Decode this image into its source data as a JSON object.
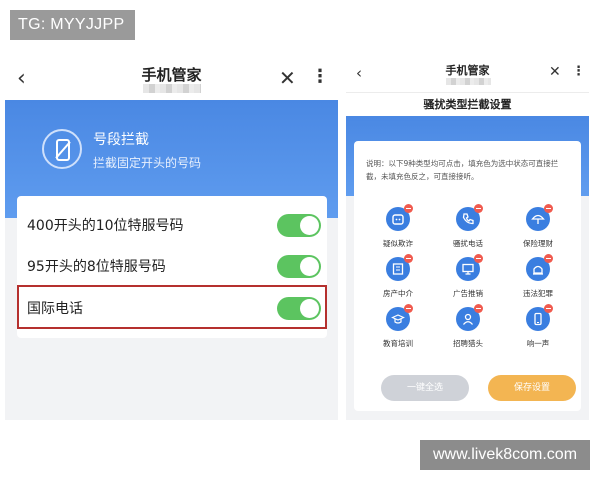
{
  "watermarks": {
    "top": "TG: MYYJJPP",
    "bottom": "www.livek8com.com"
  },
  "left": {
    "nav": {
      "back": "‹",
      "title": "手机管家",
      "close": "✕",
      "more": "⋮"
    },
    "banner": {
      "title": "号段拦截",
      "subtitle": "拦截固定开头的号码",
      "icon": "phone-slash-icon"
    },
    "rows": [
      {
        "label": "400开头的10位特服号码",
        "on": true
      },
      {
        "label": "95开头的8位特服号码",
        "on": true
      },
      {
        "label": "国际电话",
        "on": true,
        "highlighted": true
      }
    ],
    "colors": {
      "toggle_on": "#5cc460",
      "highlight": "#b5302e",
      "banner": "#4a88e3"
    }
  },
  "right": {
    "nav": {
      "back": "‹",
      "title": "手机管家",
      "close": "✕",
      "more": "⋮"
    },
    "subtitle": "骚扰类型拦截设置",
    "note": "说明：以下9种类型均可点击，填充色为选中状态可直接拦截，未填充色反之，可直接接听。",
    "categories": [
      {
        "label": "疑似欺诈",
        "icon": "suspected-fraud-icon",
        "selected": true
      },
      {
        "label": "骚扰电话",
        "icon": "harassment-call-icon",
        "selected": true
      },
      {
        "label": "保险理财",
        "icon": "insurance-icon",
        "selected": true
      },
      {
        "label": "房产中介",
        "icon": "real-estate-icon",
        "selected": true
      },
      {
        "label": "广告推销",
        "icon": "advertising-icon",
        "selected": true
      },
      {
        "label": "违法犯罪",
        "icon": "crime-icon",
        "selected": true
      },
      {
        "label": "教育培训",
        "icon": "education-icon",
        "selected": true
      },
      {
        "label": "招聘猎头",
        "icon": "recruitment-icon",
        "selected": true
      },
      {
        "label": "响一声",
        "icon": "one-ring-icon",
        "selected": true
      }
    ],
    "buttons": {
      "select_all": "一键全选",
      "save": "保存设置"
    },
    "colors": {
      "category": "#3a7ee0",
      "badge": "#f05b4f",
      "save": "#f3b552",
      "select_all": "#cfd2d8"
    }
  }
}
